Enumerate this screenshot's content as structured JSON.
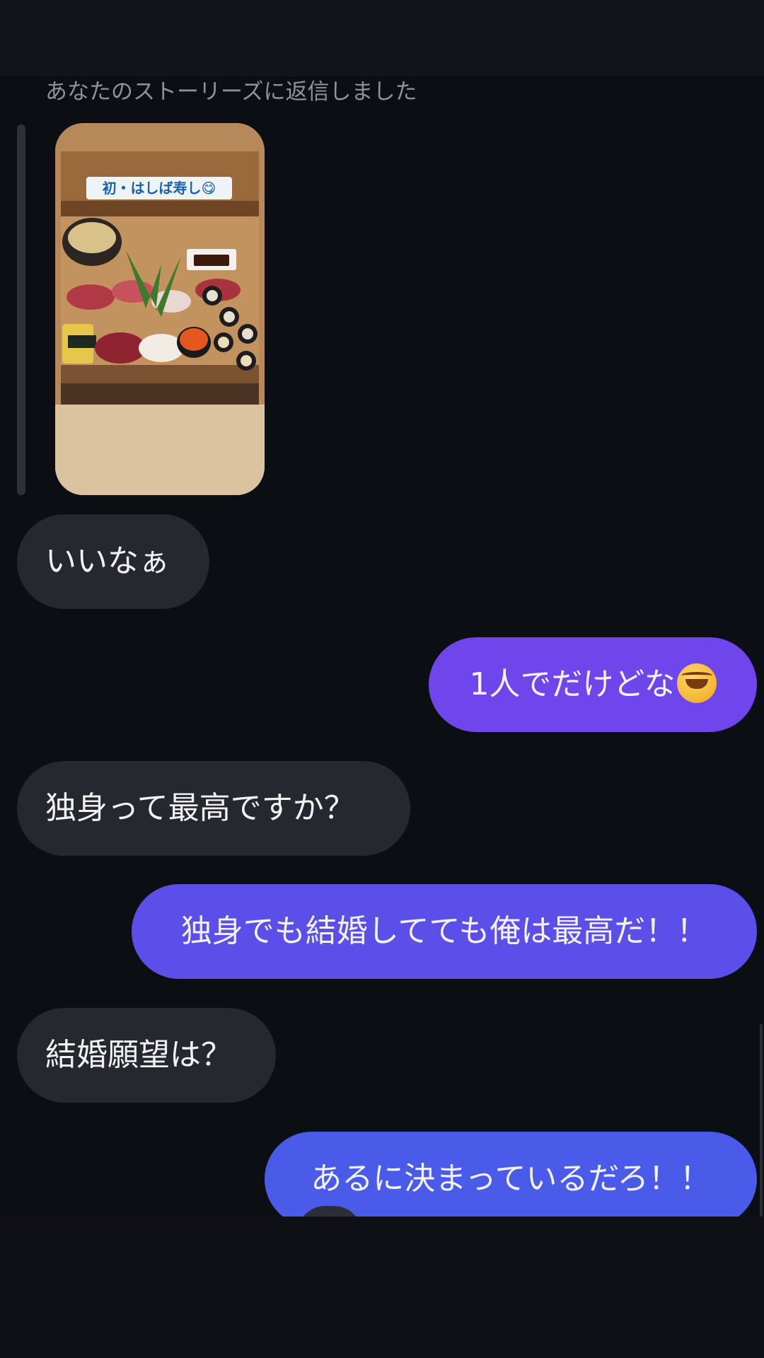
{
  "chat": {
    "reply_note": "あなたのストーリーズに返信しました",
    "story": {
      "caption": "初・はしば寿し😋",
      "image_description": "sushi platter story thumbnail"
    },
    "messages": [
      {
        "direction": "incoming",
        "text": "いいなぁ"
      },
      {
        "direction": "outgoing",
        "text": "1人でだけどな",
        "emoji": "rolling-on-floor-laughing",
        "color": "#6f45ec"
      },
      {
        "direction": "incoming",
        "text": "独身って最高ですか？"
      },
      {
        "direction": "outgoing",
        "text": "独身でも結婚してても俺は最高だ！！",
        "color": "#5c4ee8"
      },
      {
        "direction": "incoming",
        "text": "結婚願望は？"
      },
      {
        "direction": "outgoing",
        "text": "あるに決まっているだろ！！",
        "color": "#4a5be9"
      }
    ]
  },
  "colors": {
    "background": "#0b0e13",
    "incoming_bubble": "#25282e",
    "outgoing_gradient_top": "#6f45ec",
    "outgoing_gradient_bottom": "#4a5be9"
  }
}
